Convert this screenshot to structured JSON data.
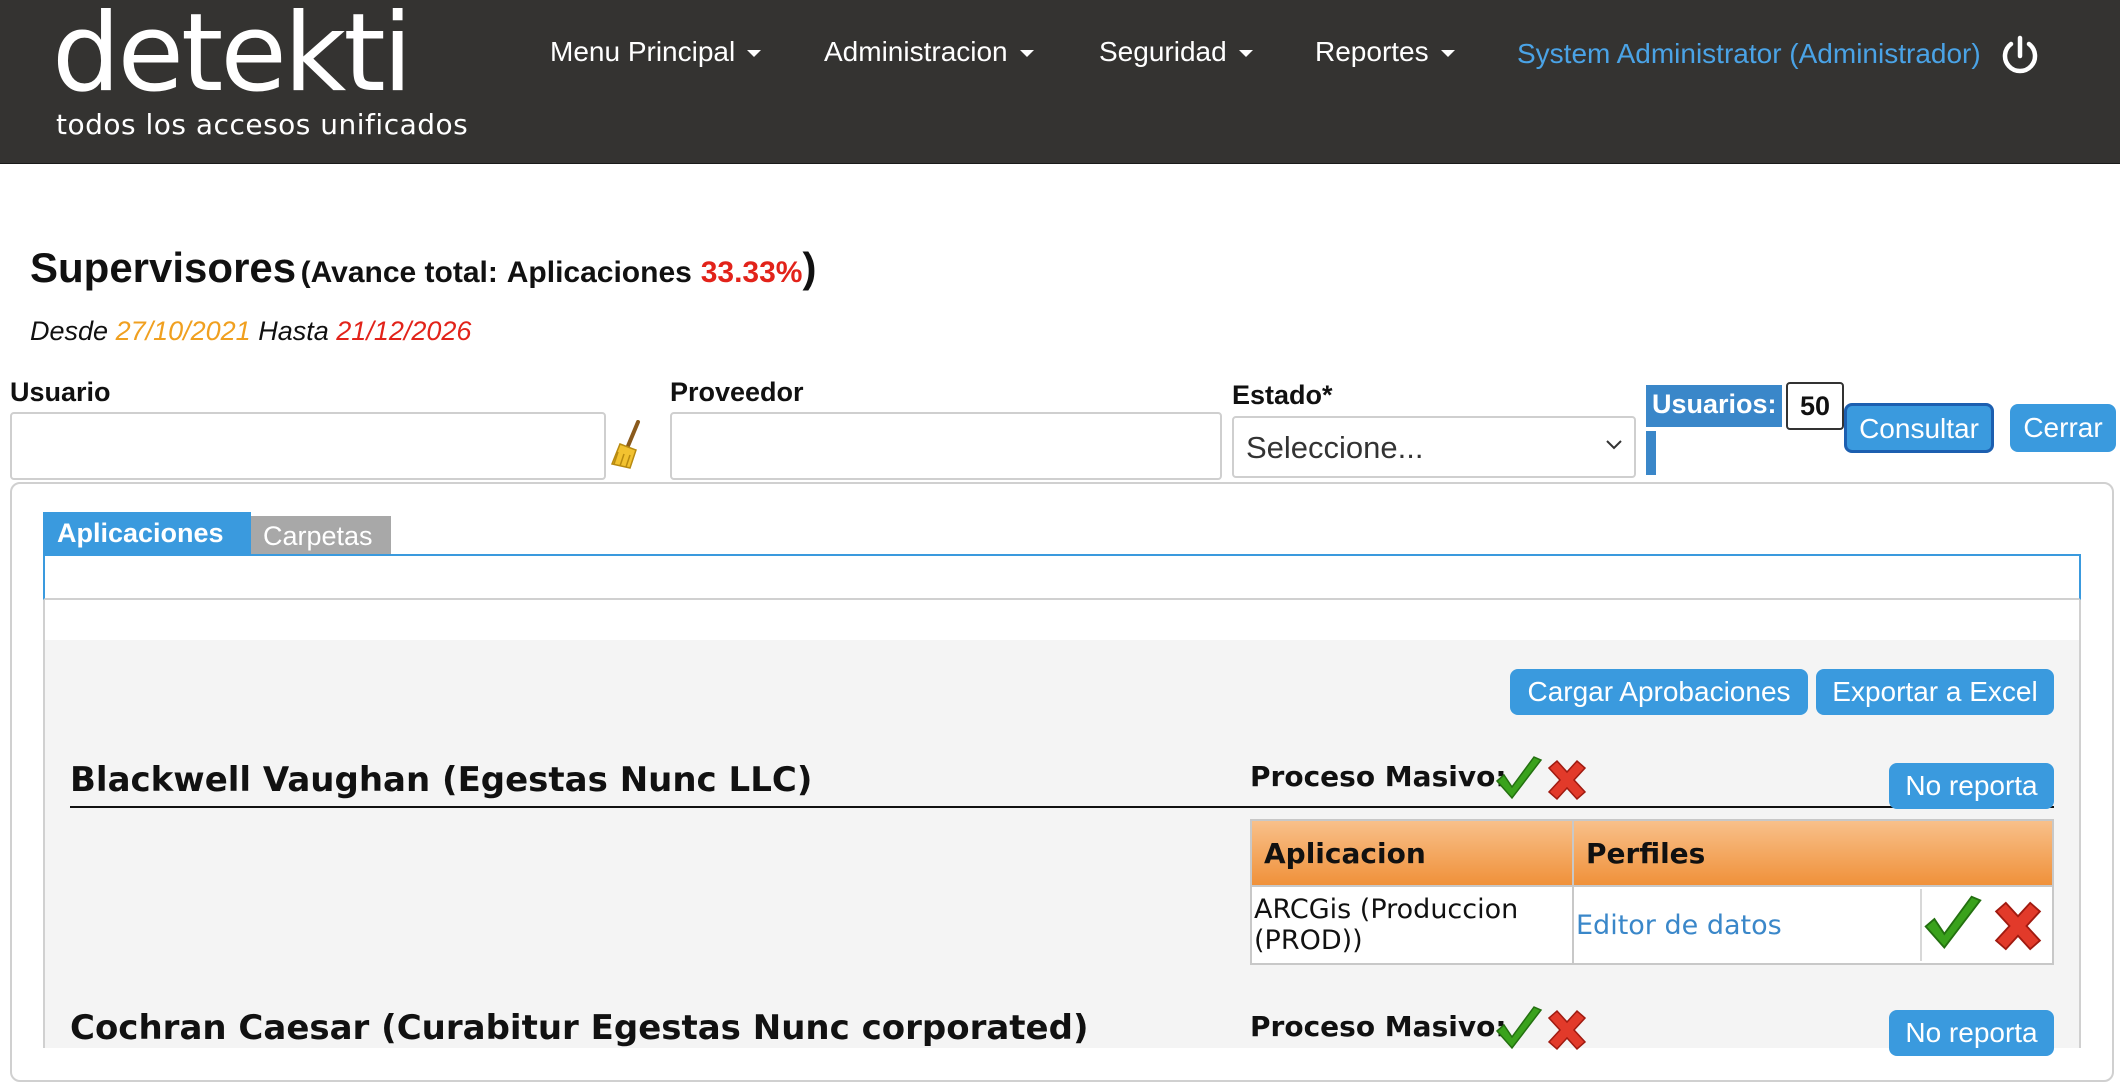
{
  "header": {
    "logo_word": "detekti",
    "logo_tagline": "todos los accesos unificados",
    "nav": [
      {
        "label": "Menu Principal"
      },
      {
        "label": "Administracion"
      },
      {
        "label": "Seguridad"
      },
      {
        "label": "Reportes"
      }
    ],
    "user_label": "System Administrator (Administrador)",
    "icons": {
      "power": "power-icon"
    }
  },
  "title": {
    "main": "Supervisores",
    "sub_open": "(Avance total:",
    "sub_app": "Aplicaciones",
    "percent": "33.33%",
    "close": ")"
  },
  "dates": {
    "desde_label": "Desde",
    "desde_value": "27/10/2021",
    "hasta_label": "Hasta",
    "hasta_value": "21/12/2026"
  },
  "filters": {
    "usuario_label": "Usuario",
    "usuario_value": "",
    "proveedor_label": "Proveedor",
    "proveedor_value": "",
    "estado_label": "Estado*",
    "estado_selected": "Seleccione...",
    "usuarios_label": "Usuarios:",
    "usuarios_count": "50",
    "consultar_label": "Consultar",
    "cerrar_label": "Cerrar"
  },
  "tabs": [
    {
      "label": "Aplicaciones",
      "active": true
    },
    {
      "label": "Carpetas",
      "active": false
    }
  ],
  "actions": {
    "cargar": "Cargar Aprobaciones",
    "exportar": "Exportar a Excel"
  },
  "supervisors": [
    {
      "name": "Blackwell Vaughan (Egestas Nunc LLC)",
      "masivo_label": "Proceso Masivo:",
      "no_reporta": "No reporta",
      "table": {
        "headers": [
          "Aplicacion",
          "Perfiles"
        ],
        "rows": [
          {
            "aplicacion": "ARCGis (Produccion (PROD))",
            "perfil": "Editor de datos"
          }
        ]
      }
    },
    {
      "name": "Cochran Caesar (Curabitur Egestas Nunc corporated)",
      "masivo_label": "Proceso Masivo:",
      "no_reporta": "No reporta"
    }
  ],
  "colors": {
    "header_bg": "#343331",
    "accent_blue": "#3a9ade",
    "user_link": "#4aa3e6",
    "percent_red": "#e2231a",
    "date_orange": "#f0a020",
    "table_header_orange": "#f0913a"
  }
}
